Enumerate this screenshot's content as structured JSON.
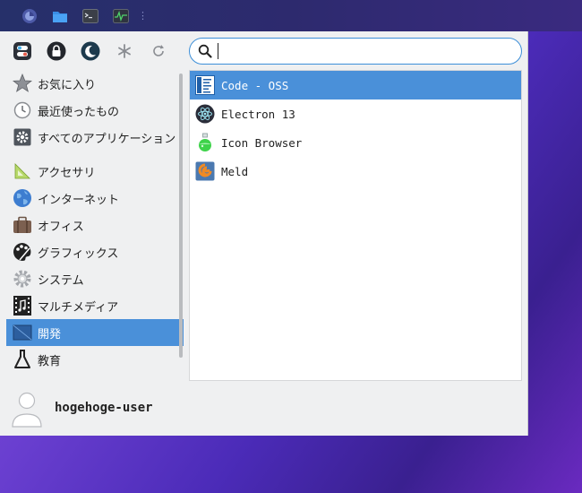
{
  "panel": {
    "launcher_icon": "xfce-menu-icon",
    "apps": [
      "firefox-icon",
      "file-manager-icon",
      "terminal-icon",
      "system-monitor-icon"
    ]
  },
  "toolbar": {
    "buttons": [
      "settings-toggle-icon",
      "lock-icon",
      "moon-icon",
      "asterisk-icon",
      "refresh-icon"
    ]
  },
  "search": {
    "value": "",
    "placeholder": ""
  },
  "categories": [
    {
      "label": "お気に入り",
      "icon": "star-icon"
    },
    {
      "label": "最近使ったもの",
      "icon": "clock-icon"
    },
    {
      "label": "すべてのアプリケーション",
      "icon": "gear-icon"
    },
    {
      "label": "アクセサリ",
      "icon": "ruler-icon"
    },
    {
      "label": "インターネット",
      "icon": "globe-icon"
    },
    {
      "label": "オフィス",
      "icon": "briefcase-icon"
    },
    {
      "label": "グラフィックス",
      "icon": "palette-icon"
    },
    {
      "label": "システム",
      "icon": "cog-icon"
    },
    {
      "label": "マルチメディア",
      "icon": "film-icon"
    },
    {
      "label": "開発",
      "icon": "development-icon",
      "selected": true
    },
    {
      "label": "教育",
      "icon": "flask-icon"
    }
  ],
  "apps": [
    {
      "label": "Code - OSS",
      "icon": "code-oss-icon",
      "selected": true
    },
    {
      "label": "Electron 13",
      "icon": "electron-icon"
    },
    {
      "label": "Icon Browser",
      "icon": "potion-icon"
    },
    {
      "label": "Meld",
      "icon": "meld-icon"
    }
  ],
  "user": {
    "name": "hogehoge-user",
    "icon": "avatar-icon"
  },
  "colors": {
    "accent": "#4a90d9",
    "panel": "#2b2e6c",
    "menu_bg": "#eff0f1"
  }
}
